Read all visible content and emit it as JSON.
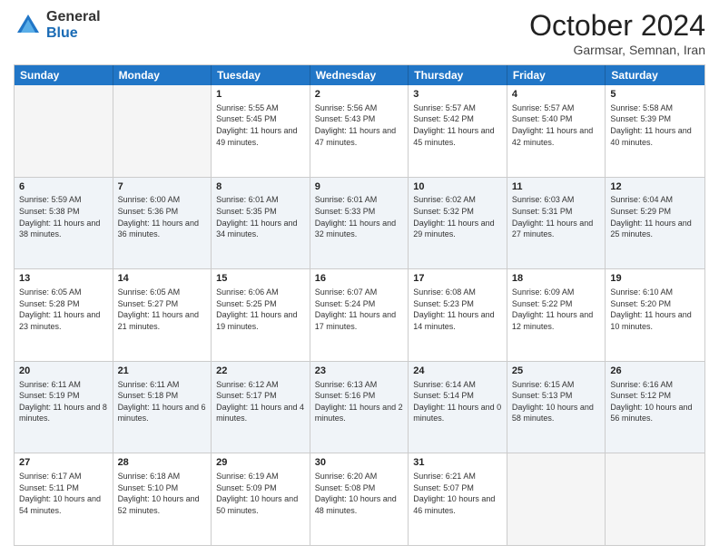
{
  "header": {
    "logo": {
      "line1": "General",
      "line2": "Blue"
    },
    "title": "October 2024",
    "location": "Garmsar, Semnan, Iran"
  },
  "weekdays": [
    "Sunday",
    "Monday",
    "Tuesday",
    "Wednesday",
    "Thursday",
    "Friday",
    "Saturday"
  ],
  "rows": [
    [
      {
        "day": "",
        "info": "",
        "empty": true
      },
      {
        "day": "",
        "info": "",
        "empty": true
      },
      {
        "day": "1",
        "info": "Sunrise: 5:55 AM\nSunset: 5:45 PM\nDaylight: 11 hours and 49 minutes."
      },
      {
        "day": "2",
        "info": "Sunrise: 5:56 AM\nSunset: 5:43 PM\nDaylight: 11 hours and 47 minutes."
      },
      {
        "day": "3",
        "info": "Sunrise: 5:57 AM\nSunset: 5:42 PM\nDaylight: 11 hours and 45 minutes."
      },
      {
        "day": "4",
        "info": "Sunrise: 5:57 AM\nSunset: 5:40 PM\nDaylight: 11 hours and 42 minutes."
      },
      {
        "day": "5",
        "info": "Sunrise: 5:58 AM\nSunset: 5:39 PM\nDaylight: 11 hours and 40 minutes."
      }
    ],
    [
      {
        "day": "6",
        "info": "Sunrise: 5:59 AM\nSunset: 5:38 PM\nDaylight: 11 hours and 38 minutes."
      },
      {
        "day": "7",
        "info": "Sunrise: 6:00 AM\nSunset: 5:36 PM\nDaylight: 11 hours and 36 minutes."
      },
      {
        "day": "8",
        "info": "Sunrise: 6:01 AM\nSunset: 5:35 PM\nDaylight: 11 hours and 34 minutes."
      },
      {
        "day": "9",
        "info": "Sunrise: 6:01 AM\nSunset: 5:33 PM\nDaylight: 11 hours and 32 minutes."
      },
      {
        "day": "10",
        "info": "Sunrise: 6:02 AM\nSunset: 5:32 PM\nDaylight: 11 hours and 29 minutes."
      },
      {
        "day": "11",
        "info": "Sunrise: 6:03 AM\nSunset: 5:31 PM\nDaylight: 11 hours and 27 minutes."
      },
      {
        "day": "12",
        "info": "Sunrise: 6:04 AM\nSunset: 5:29 PM\nDaylight: 11 hours and 25 minutes."
      }
    ],
    [
      {
        "day": "13",
        "info": "Sunrise: 6:05 AM\nSunset: 5:28 PM\nDaylight: 11 hours and 23 minutes."
      },
      {
        "day": "14",
        "info": "Sunrise: 6:05 AM\nSunset: 5:27 PM\nDaylight: 11 hours and 21 minutes."
      },
      {
        "day": "15",
        "info": "Sunrise: 6:06 AM\nSunset: 5:25 PM\nDaylight: 11 hours and 19 minutes."
      },
      {
        "day": "16",
        "info": "Sunrise: 6:07 AM\nSunset: 5:24 PM\nDaylight: 11 hours and 17 minutes."
      },
      {
        "day": "17",
        "info": "Sunrise: 6:08 AM\nSunset: 5:23 PM\nDaylight: 11 hours and 14 minutes."
      },
      {
        "day": "18",
        "info": "Sunrise: 6:09 AM\nSunset: 5:22 PM\nDaylight: 11 hours and 12 minutes."
      },
      {
        "day": "19",
        "info": "Sunrise: 6:10 AM\nSunset: 5:20 PM\nDaylight: 11 hours and 10 minutes."
      }
    ],
    [
      {
        "day": "20",
        "info": "Sunrise: 6:11 AM\nSunset: 5:19 PM\nDaylight: 11 hours and 8 minutes."
      },
      {
        "day": "21",
        "info": "Sunrise: 6:11 AM\nSunset: 5:18 PM\nDaylight: 11 hours and 6 minutes."
      },
      {
        "day": "22",
        "info": "Sunrise: 6:12 AM\nSunset: 5:17 PM\nDaylight: 11 hours and 4 minutes."
      },
      {
        "day": "23",
        "info": "Sunrise: 6:13 AM\nSunset: 5:16 PM\nDaylight: 11 hours and 2 minutes."
      },
      {
        "day": "24",
        "info": "Sunrise: 6:14 AM\nSunset: 5:14 PM\nDaylight: 11 hours and 0 minutes."
      },
      {
        "day": "25",
        "info": "Sunrise: 6:15 AM\nSunset: 5:13 PM\nDaylight: 10 hours and 58 minutes."
      },
      {
        "day": "26",
        "info": "Sunrise: 6:16 AM\nSunset: 5:12 PM\nDaylight: 10 hours and 56 minutes."
      }
    ],
    [
      {
        "day": "27",
        "info": "Sunrise: 6:17 AM\nSunset: 5:11 PM\nDaylight: 10 hours and 54 minutes."
      },
      {
        "day": "28",
        "info": "Sunrise: 6:18 AM\nSunset: 5:10 PM\nDaylight: 10 hours and 52 minutes."
      },
      {
        "day": "29",
        "info": "Sunrise: 6:19 AM\nSunset: 5:09 PM\nDaylight: 10 hours and 50 minutes."
      },
      {
        "day": "30",
        "info": "Sunrise: 6:20 AM\nSunset: 5:08 PM\nDaylight: 10 hours and 48 minutes."
      },
      {
        "day": "31",
        "info": "Sunrise: 6:21 AM\nSunset: 5:07 PM\nDaylight: 10 hours and 46 minutes."
      },
      {
        "day": "",
        "info": "",
        "empty": true
      },
      {
        "day": "",
        "info": "",
        "empty": true
      }
    ]
  ]
}
